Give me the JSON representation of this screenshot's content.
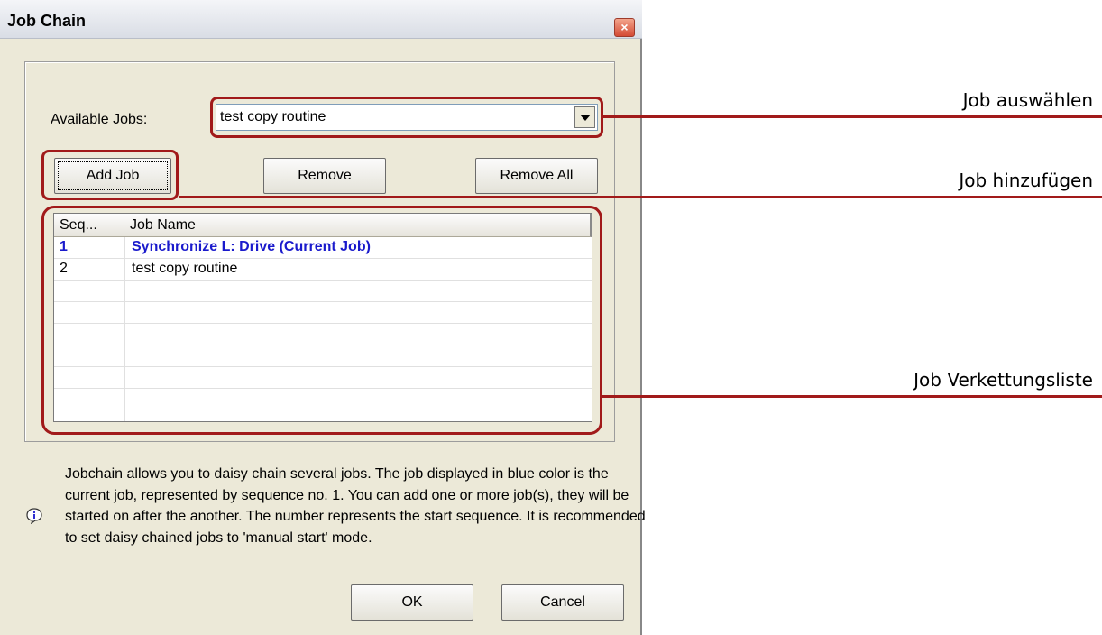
{
  "window": {
    "title": "Job Chain",
    "close_glyph": "×"
  },
  "available_jobs": {
    "label": "Available Jobs:",
    "selected": "test copy routine"
  },
  "buttons": {
    "add": "Add Job",
    "remove": "Remove",
    "remove_all": "Remove All",
    "ok": "OK",
    "cancel": "Cancel"
  },
  "list": {
    "columns": [
      "Seq...",
      "Job Name"
    ],
    "rows": [
      {
        "seq": "1",
        "name": "Synchronize L: Drive (Current Job)",
        "current": true
      },
      {
        "seq": "2",
        "name": "test copy routine",
        "current": false
      }
    ]
  },
  "info": {
    "text": "Jobchain allows you to daisy chain several jobs. The job displayed in blue color is the current job, represented by sequence no. 1. You can add one or more job(s), they will be started on after the another. The number represents the start sequence. It is recommended to set daisy chained jobs to 'manual start' mode."
  },
  "annotations": {
    "select_job": "Job auswählen",
    "add_job": "Job hinzufügen",
    "chain_list": "Job Verkettungsliste"
  },
  "colors": {
    "current_job": "#1a1acc",
    "callout": "#a11a1a"
  },
  "icons": {
    "close": "close-icon",
    "info": "info-icon",
    "dropdown": "chevron-down-icon"
  }
}
